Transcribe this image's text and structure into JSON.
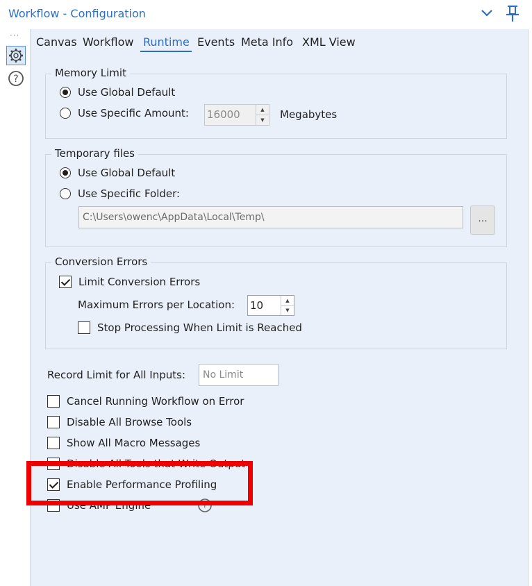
{
  "header": {
    "title": "Workflow - Configuration"
  },
  "tabs": [
    {
      "label": "Canvas"
    },
    {
      "label": "Workflow"
    },
    {
      "label": "Runtime"
    },
    {
      "label": "Events"
    },
    {
      "label": "Meta Info"
    },
    {
      "label": "XML View"
    }
  ],
  "active_tab": "Runtime",
  "memory_limit": {
    "legend": "Memory Limit",
    "global_label": "Use Global Default",
    "specific_label": "Use Specific Amount:",
    "amount_value": "16000",
    "unit": "Megabytes",
    "selected": "global"
  },
  "temp_files": {
    "legend": "Temporary files",
    "global_label": "Use Global Default",
    "specific_label": "Use Specific Folder:",
    "folder_path": "C:\\Users\\owenc\\AppData\\Local\\Temp\\",
    "browse_label": "...",
    "selected": "global"
  },
  "conversion_errors": {
    "legend": "Conversion Errors",
    "limit_label": "Limit Conversion Errors",
    "limit_checked": true,
    "max_label": "Maximum Errors per Location:",
    "max_value": "10",
    "stop_label": "Stop Processing When Limit is Reached",
    "stop_checked": false
  },
  "record_limit": {
    "label": "Record Limit for All Inputs:",
    "placeholder": "No Limit"
  },
  "options": [
    {
      "label": "Cancel Running Workflow on Error",
      "checked": false
    },
    {
      "label": "Disable All Browse Tools",
      "checked": false
    },
    {
      "label": "Show All Macro Messages",
      "checked": false
    },
    {
      "label": "Disable All Tools that Write Output",
      "checked": false
    },
    {
      "label": "Enable Performance Profiling",
      "checked": true
    },
    {
      "label": "Use AMP Engine",
      "checked": false
    }
  ],
  "colors": {
    "accent": "#2f6fbd",
    "panel_bg": "#eaf0fa",
    "highlight": "#ee0000"
  },
  "icons": {
    "collapse": "chevron-down-icon",
    "pin": "pin-icon",
    "settings": "gear-icon",
    "help": "help-icon"
  }
}
